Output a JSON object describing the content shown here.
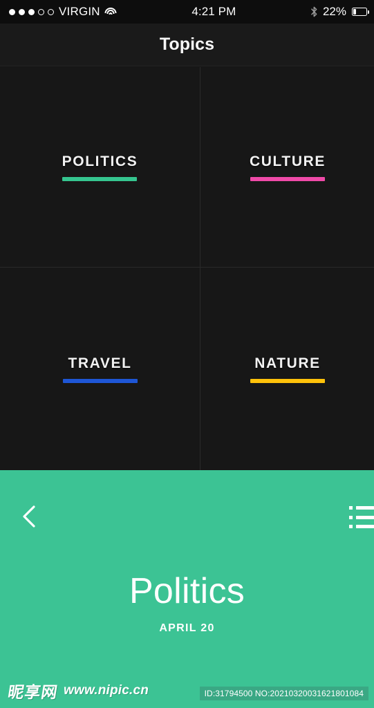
{
  "statusbar": {
    "signal_filled": 3,
    "signal_empty": 2,
    "carrier": "VIRGIN",
    "wifi_icon": "wifi-icon",
    "time": "4:21 PM",
    "bluetooth_icon": "bluetooth-icon",
    "battery_percent": "22%",
    "battery_icon": "battery-icon"
  },
  "navbar": {
    "title": "Topics"
  },
  "grid": {
    "cells": [
      {
        "label": "POLITICS",
        "accent": "#35c58f"
      },
      {
        "label": "CULTURE",
        "accent": "#ef4aa8"
      },
      {
        "label": "TRAVEL",
        "accent": "#1e56d6"
      },
      {
        "label": "NATURE",
        "accent": "#ffc20a"
      }
    ]
  },
  "panel": {
    "background": "#3cc394",
    "back_icon": "chevron-left-icon",
    "menu_icon": "list-menu-icon",
    "title": "Politics",
    "date": "APRIL 20"
  },
  "watermark": {
    "logo_cn": "昵享网",
    "url": "www.nipic.cn",
    "id_text": "ID:31794500 NO:20210320031621801084"
  }
}
